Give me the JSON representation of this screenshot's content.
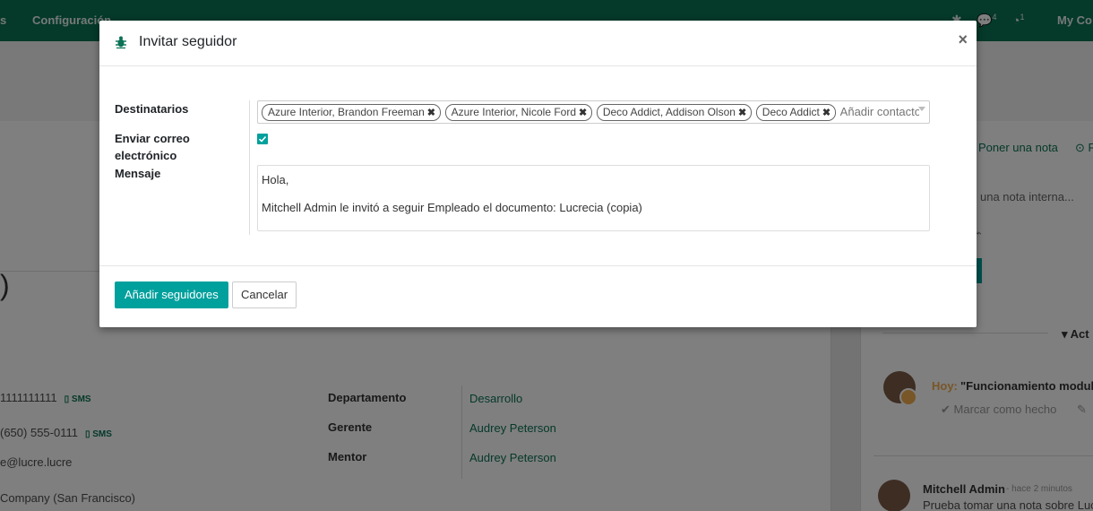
{
  "topbar": {
    "menu_left_partial": "s",
    "menu_config": "Configuración",
    "messages_count": "4",
    "activities_count": "1",
    "company_partial": "My Co"
  },
  "background": {
    "phone_mobile": "1111111111",
    "phone_work": "(650) 555-0111",
    "sms_label": "SMS",
    "email_partial": "e@lucre.lucre",
    "company_partial": "Company (San Francisco)",
    "department_label": "Departamento",
    "department_value": "Desarrollo",
    "manager_label": "Gerente",
    "manager_value": "Audrey Peterson",
    "mentor_label": "Mentor",
    "mentor_value": "Audrey Peterson"
  },
  "chatter": {
    "tab_note": "Poner una nota",
    "tab_partial": "F",
    "note_placeholder_partial": "una nota interna...",
    "activities_partial": "Act",
    "activity_today": "Hoy:",
    "activity_title_partial": "\"Funcionamiento modulo",
    "mark_done": "Marcar como hecho",
    "message_author": "Mitchell Admin",
    "message_time": "- hace 2 minutos",
    "message_body_partial": "Prueba tomar una nota sobre Luc"
  },
  "dialog": {
    "title": "Invitar seguidor",
    "close_symbol": "×",
    "recipients_label": "Destinatarios",
    "recipients": [
      {
        "label": "Azure Interior, Brandon Freeman"
      },
      {
        "label": "Azure Interior, Nicole Ford"
      },
      {
        "label": "Deco Addict, Addison Olson"
      },
      {
        "label": "Deco Addict"
      }
    ],
    "recipients_placeholder": "Añadir contactos",
    "send_email_label": "Enviar correo electrónico",
    "send_email_checked": true,
    "message_label": "Mensaje",
    "message_lines": [
      "Hola,",
      "Mitchell Admin le invitó a seguir Empleado el documento: Lucrecia (copia)"
    ],
    "submit_label": "Añadir seguidores",
    "cancel_label": "Cancelar"
  },
  "colors": {
    "brand": "#0b7255",
    "primary_button": "#00a09d"
  }
}
